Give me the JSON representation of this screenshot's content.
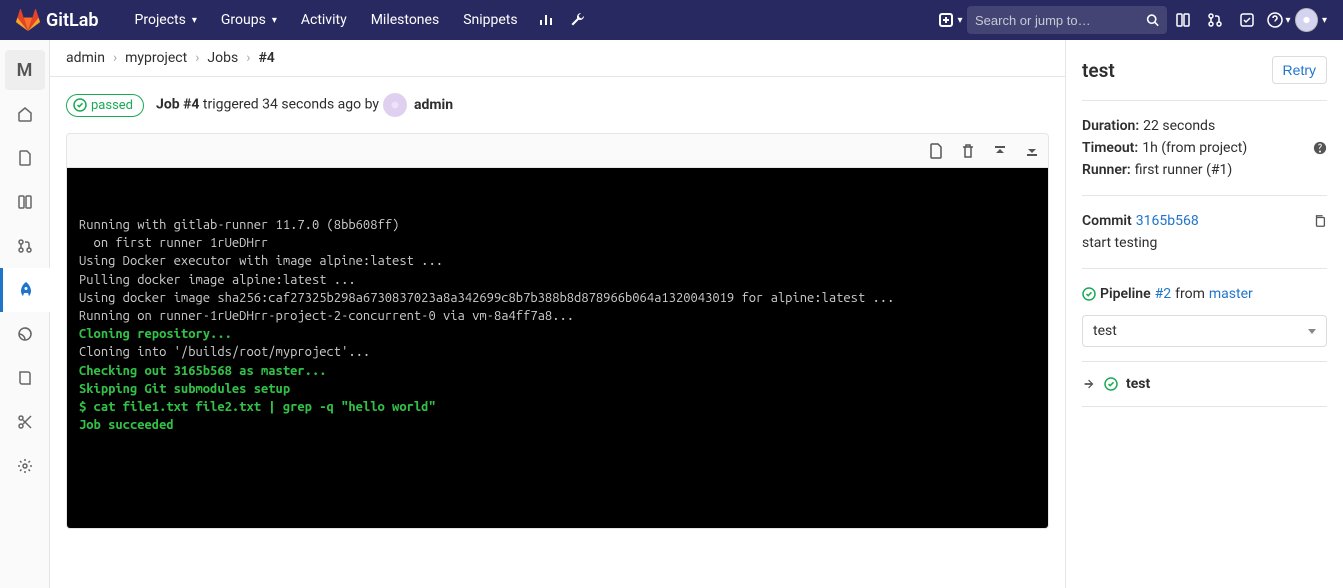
{
  "navbar": {
    "brand": "GitLab",
    "projects": "Projects",
    "groups": "Groups",
    "activity": "Activity",
    "milestones": "Milestones",
    "snippets": "Snippets",
    "search_placeholder": "Search or jump to…"
  },
  "sidebar": {
    "project_letter": "M"
  },
  "breadcrumb": {
    "namespace": "admin",
    "project": "myproject",
    "section": "Jobs",
    "current": "#4"
  },
  "job": {
    "status": "passed",
    "title_prefix": "Job #4",
    "triggered_text": " triggered 34 seconds ago by ",
    "user": "admin"
  },
  "log": {
    "l1": "Running with gitlab-runner 11.7.0 (8bb608ff)",
    "l2": "  on first runner 1rUeDHrr",
    "l3": "Using Docker executor with image alpine:latest ...",
    "l4": "Pulling docker image alpine:latest ...",
    "l5": "Using docker image sha256:caf27325b298a6730837023a8a342699c8b7b388b8d878966b064a1320043019 for alpine:latest ...",
    "l6": "Running on runner-1rUeDHrr-project-2-concurrent-0 via vm-8a4ff7a8...",
    "l7": "Cloning repository...",
    "l8": "Cloning into '/builds/root/myproject'...",
    "l9": "Checking out 3165b568 as master...",
    "l10": "Skipping Git submodules setup",
    "l11": "$ cat file1.txt file2.txt | grep -q \"hello world\"",
    "l12": "Job succeeded"
  },
  "panel": {
    "title": "test",
    "retry": "Retry",
    "duration_label": "Duration:",
    "duration_value": " 22 seconds",
    "timeout_label": "Timeout:",
    "timeout_value": " 1h (from project)",
    "runner_label": "Runner:",
    "runner_value": " first runner (#1)",
    "commit_label": "Commit ",
    "commit_sha": "3165b568",
    "commit_msg": "start testing",
    "pipeline_label": "Pipeline ",
    "pipeline_id": "#2",
    "pipeline_from": " from ",
    "pipeline_branch": "master",
    "select_value": "test",
    "stage_job": "test"
  }
}
